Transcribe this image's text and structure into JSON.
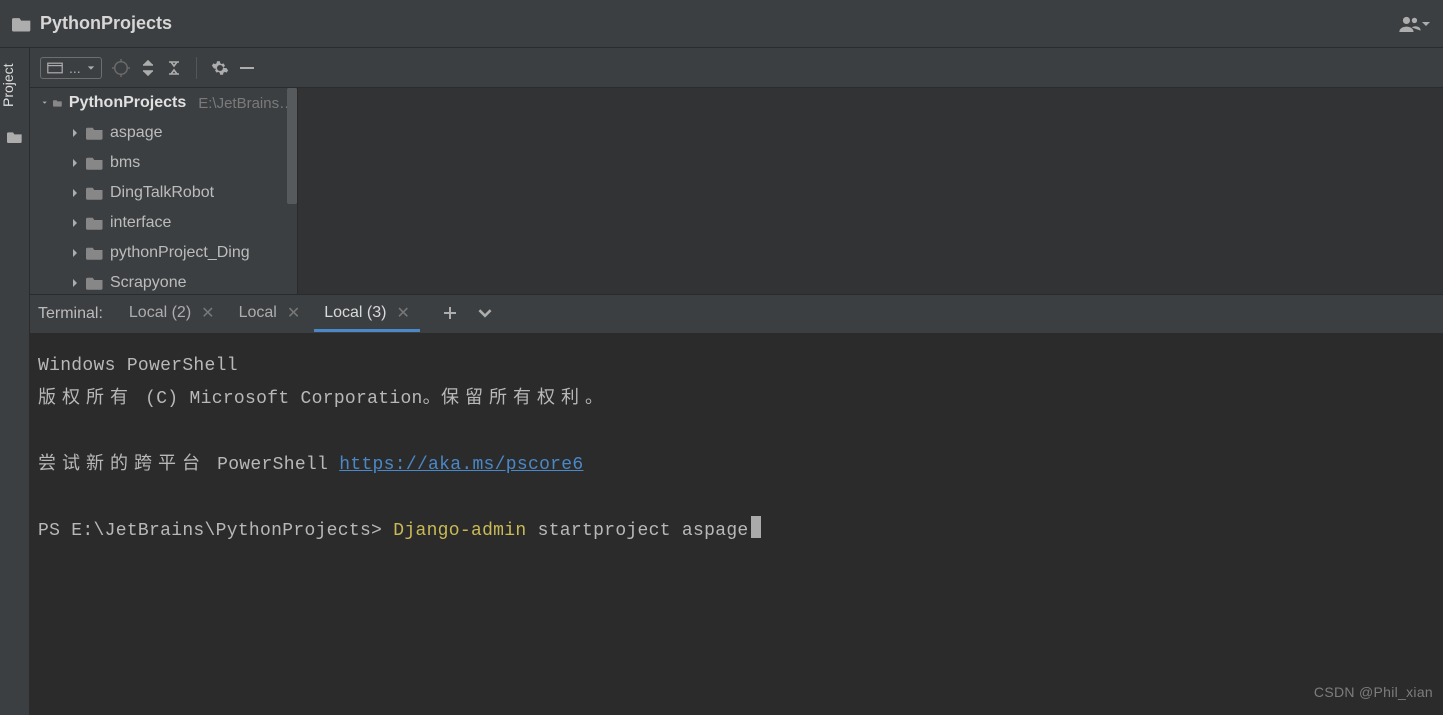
{
  "header": {
    "project_name": "PythonProjects"
  },
  "sidebar": {
    "label": "Project"
  },
  "toolbar": {
    "select_label": "..."
  },
  "tree": {
    "root_name": "PythonProjects",
    "root_path": "E:\\JetBrains\\PythonProjects",
    "items": [
      {
        "name": "aspage"
      },
      {
        "name": "bms"
      },
      {
        "name": "DingTalkRobot"
      },
      {
        "name": "interface"
      },
      {
        "name": "pythonProject_Ding"
      },
      {
        "name": "Scrapyone"
      }
    ]
  },
  "terminal": {
    "title": "Terminal:",
    "tabs": [
      {
        "label": "Local (2)",
        "active": false
      },
      {
        "label": "Local",
        "active": false
      },
      {
        "label": "Local (3)",
        "active": true
      }
    ],
    "lines": {
      "l1": "Windows PowerShell",
      "l2_pre": "版权所有",
      "l2_mid": " (C) Microsoft Corporation。",
      "l2_post": "保留所有权利。",
      "l3_pre": "尝试新的跨平台",
      "l3_mid": " PowerShell ",
      "l3_link": "https://aka.ms/pscore6",
      "prompt_path": "PS E:\\JetBrains\\PythonProjects> ",
      "prompt_cmd": "Django-admin",
      "prompt_args": " startproject aspage"
    }
  },
  "watermark": "CSDN @Phil_xian"
}
